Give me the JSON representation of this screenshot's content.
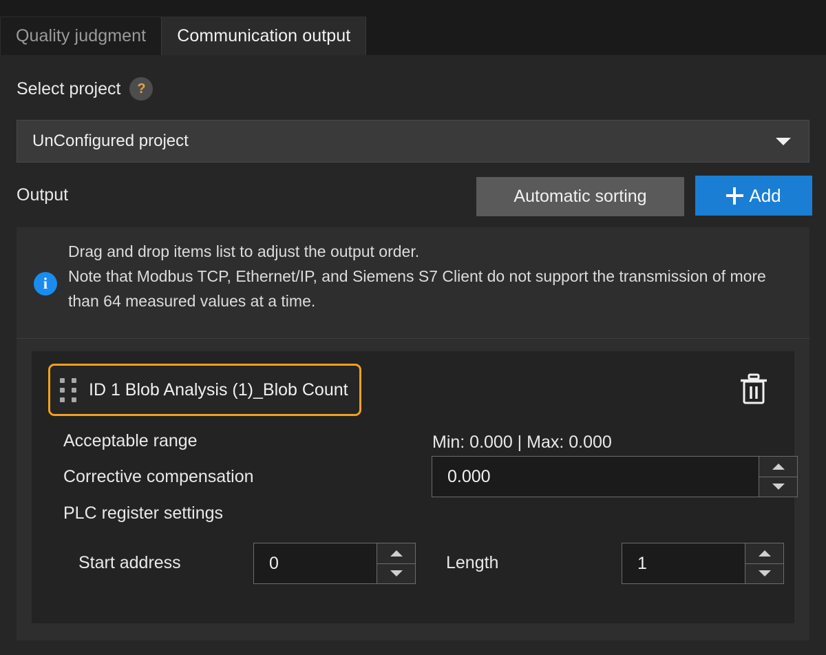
{
  "tabs": [
    {
      "label": "Quality judgment",
      "active": false
    },
    {
      "label": "Communication output",
      "active": true
    }
  ],
  "project": {
    "label": "Select project",
    "help_icon": "question-mark-icon",
    "selected": "UnConfigured project",
    "caret_icon": "chevron-down-icon"
  },
  "output": {
    "label": "Output",
    "sort_button": "Automatic sorting",
    "add_button": "Add",
    "add_icon": "plus-icon"
  },
  "note": {
    "icon": "info-icon",
    "line1": "Drag and drop items list to adjust the output order.",
    "line2": "Note that Modbus TCP, Ethernet/IP, and Siemens S7 Client do not support the transmission of more than 64 measured values at a time."
  },
  "item": {
    "drag_handle_icon": "drag-handle-icon",
    "title": "ID 1  Blob Analysis (1)_Blob Count",
    "delete_icon": "trash-icon",
    "selected_border_color": "#f5a01e"
  },
  "details": {
    "acceptable_range_label": "Acceptable range",
    "acceptable_range_value": "Min: 0.000 | Max: 0.000",
    "corrective_compensation_label": "Corrective compensation",
    "corrective_compensation_value": "0.000",
    "plc_register_label": "PLC register settings",
    "start_address_label": "Start address",
    "start_address_value": "0",
    "length_label": "Length",
    "length_value": "1"
  },
  "colors": {
    "accent_blue": "#1a7fd4",
    "accent_orange": "#f5a01e",
    "info_blue": "#1a8cf0",
    "background": "#262626",
    "panel": "#2e2e2e"
  }
}
